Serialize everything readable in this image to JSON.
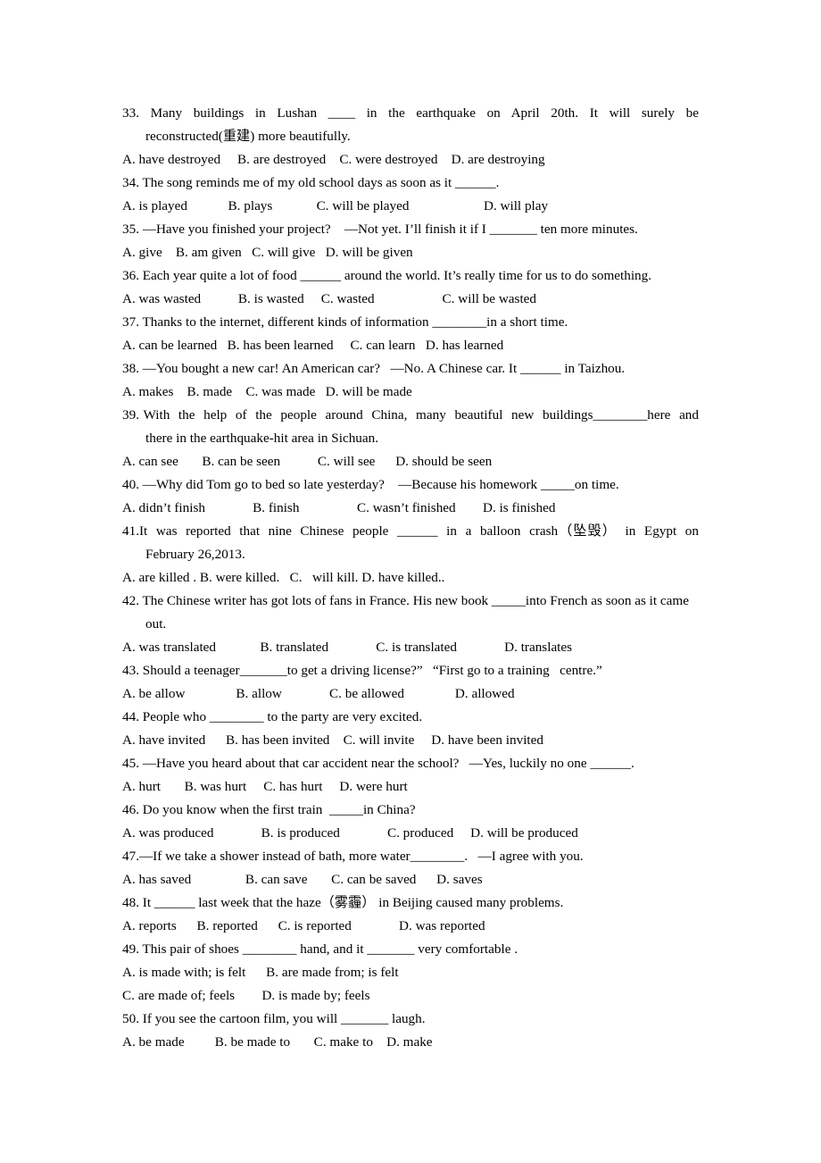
{
  "document": {
    "type": "worksheet",
    "subject": "English grammar multiple-choice exercise (passive voice)",
    "page_background": "#ffffff",
    "text_color": "#000000"
  },
  "questions": [
    {
      "number": "33",
      "stem": "33.  Many  buildings  in  Lushan  ____  in  the  earthquake  on  April  20th.  It  will  surely  be reconstructed(重建) more beautifully.",
      "options": "A. have destroyed     B. are destroyed    C. were destroyed    D. are destroying"
    },
    {
      "number": "34",
      "stem": "34. The song reminds me of my old school days as soon as it ______.",
      "options": "A. is played            B. plays             C. will be played                      D. will play"
    },
    {
      "number": "35",
      "stem": "35. —Have you finished your project?    —Not yet. I’ll finish it if I _______ ten more minutes.",
      "options": "A. give    B. am given   C. will give   D. will be given"
    },
    {
      "number": "36",
      "stem": "36. Each year quite a lot of food ______ around the world. It’s really time for us to do something.",
      "options": "A. was wasted           B. is wasted     C. wasted                    C. will be wasted"
    },
    {
      "number": "37",
      "stem": "37. Thanks to the internet, different kinds of information ________in a short time.",
      "options": "A. can be learned   B. has been learned     C. can learn   D. has learned"
    },
    {
      "number": "38",
      "stem": "38. —You bought a new car! An American car?   —No. A Chinese car. It ______ in Taizhou.",
      "options": "A. makes    B. made    C. was made   D. will be made"
    },
    {
      "number": "39",
      "stem": "39. With  the  help  of  the  people  around  China,  many  beautiful  new  buildings________here  and there in the earthquake-hit area in Sichuan.",
      "options": "A. can see       B. can be seen           C. will see      D. should be seen"
    },
    {
      "number": "40",
      "stem": "40. —Why did Tom go to bed so late yesterday?    —Because his homework _____on time.",
      "options": "A. didn’t finish              B. finish                 C. wasn’t finished        D. is finished"
    },
    {
      "number": "41",
      "stem": "41.It  was  reported  that  nine  Chinese  people  ______  in  a  balloon  crash（坠毁）  in  Egypt  on February 26,2013.",
      "options": "A. are killed . B. were killed.   C.   will kill. D. have killed.."
    },
    {
      "number": "42",
      "stem": "42. The Chinese writer has got lots of fans in France. His new book _____into French as soon as it came out.",
      "options": "A. was translated             B. translated              C. is translated              D. translates"
    },
    {
      "number": "43",
      "stem": "43. Should a teenager_______to get a driving license?”   “First go to a training   centre.”",
      "options": "A. be allow               B. allow              C. be allowed               D. allowed"
    },
    {
      "number": "44",
      "stem": "44. People who ________ to the party are very excited.",
      "options": "A. have invited      B. has been invited    C. will invite     D. have been invited"
    },
    {
      "number": "45",
      "stem": "45. —Have you heard about that car accident near the school?   —Yes, luckily no one ______.",
      "options": "A. hurt       B. was hurt     C. has hurt     D. were hurt"
    },
    {
      "number": "46",
      "stem": "46. Do you know when the first train  _____in China?",
      "options": "A. was produced              B. is produced              C. produced     D. will be produced"
    },
    {
      "number": "47",
      "stem": "47.—If we take a shower instead of bath, more water________.   —I agree with you.",
      "options": "A. has saved                B. can save       C. can be saved      D. saves"
    },
    {
      "number": "48",
      "stem": "48. It ______ last week that the haze（雾霾） in Beijing caused many problems.",
      "options": "A. reports      B. reported      C. is reported              D. was reported"
    },
    {
      "number": "49",
      "stem": "49. This pair of shoes ________ hand, and it _______ very comfortable .",
      "options": "A. is made with; is felt      B. are made from; is felt",
      "options_line2": "C. are made of; feels        D. is made by; feels"
    },
    {
      "number": "50",
      "stem": "50. If you see the cartoon film, you will _______ laugh.",
      "options": "A. be made         B. be made to       C. make to    D. make"
    }
  ]
}
